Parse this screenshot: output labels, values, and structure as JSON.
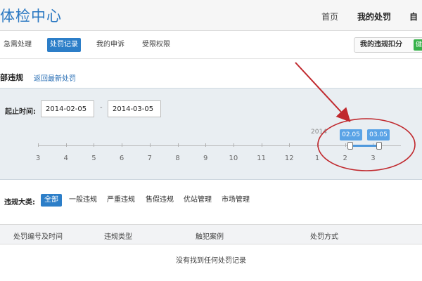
{
  "header": {
    "logo": "体检中心",
    "nav": [
      "首页",
      "我的处罚",
      "自"
    ]
  },
  "subnav": {
    "tabs": [
      "急需处理",
      "处罚记录",
      "我的申诉",
      "受限权限"
    ],
    "active_index": 1,
    "score_button": "我的违规扣分",
    "score_toggle": "健"
  },
  "section": {
    "title": "部违规",
    "link": "返回最新处罚"
  },
  "time_filter": {
    "label": "起止时间:",
    "start_date": "2014-02-05",
    "end_date": "2014-03-05",
    "separator": "-",
    "year": "2014",
    "ticks": [
      "3",
      "4",
      "5",
      "6",
      "7",
      "8",
      "9",
      "10",
      "11",
      "12",
      "1",
      "2",
      "3"
    ],
    "range_start": "02.05",
    "range_end": "03.05"
  },
  "categories": {
    "label": "违规大类:",
    "items": [
      "全部",
      "一般违规",
      "严重违规",
      "售假违规",
      "优站管理",
      "市场管理"
    ],
    "active_index": 0
  },
  "table": {
    "columns": [
      "处罚编号及时间",
      "违规类型",
      "触犯案例",
      "处罚方式"
    ],
    "empty_message": "没有找到任何处罚记录"
  },
  "colors": {
    "accent": "#2c7ec8",
    "annotation": "#c0282d",
    "toggle": "#37b24a"
  }
}
